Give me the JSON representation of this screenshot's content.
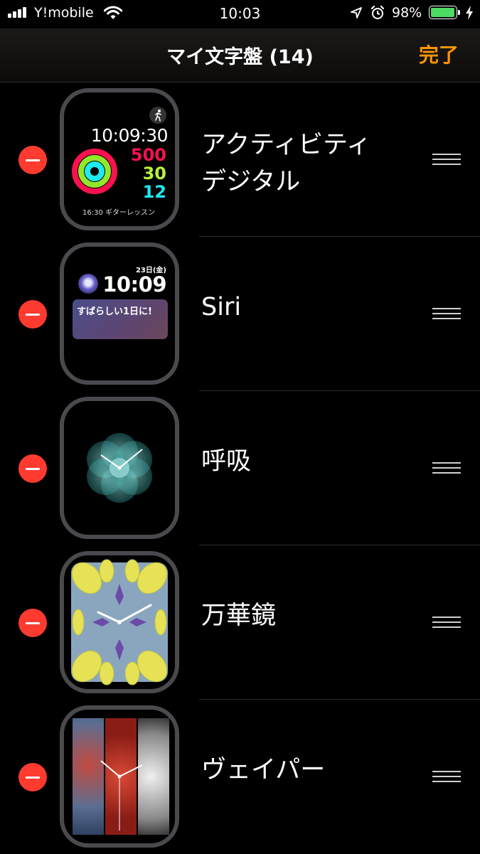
{
  "status_bar": {
    "carrier": "Y!mobile",
    "time": "10:03",
    "battery_percent": "98%",
    "battery_level": 0.98,
    "signal_bars": 4,
    "icons": [
      "wifi-icon",
      "location-arrow-icon",
      "alarm-clock-icon",
      "charging-bolt-icon"
    ]
  },
  "nav": {
    "title": "マイ文字盤 (14)",
    "done_label": "完了",
    "accent_color": "#ff9500"
  },
  "colors": {
    "delete_red": "#ff3b30",
    "move_red": "#fa114f",
    "exercise_green": "#92e82a",
    "stand_cyan": "#1eeaef"
  },
  "faces": [
    {
      "name": "アクティビティ\nデジタル",
      "complication_time": "10:09:30",
      "move": "500",
      "exercise": "30",
      "stand": "12",
      "footer": "16:30 ギターレッスン"
    },
    {
      "name": "Siri",
      "date": "23日(金)",
      "time": "10:09",
      "card_text": "すばらしい1日に!"
    },
    {
      "name": "呼吸"
    },
    {
      "name": "万華鏡"
    },
    {
      "name": "ヴェイパー"
    }
  ]
}
